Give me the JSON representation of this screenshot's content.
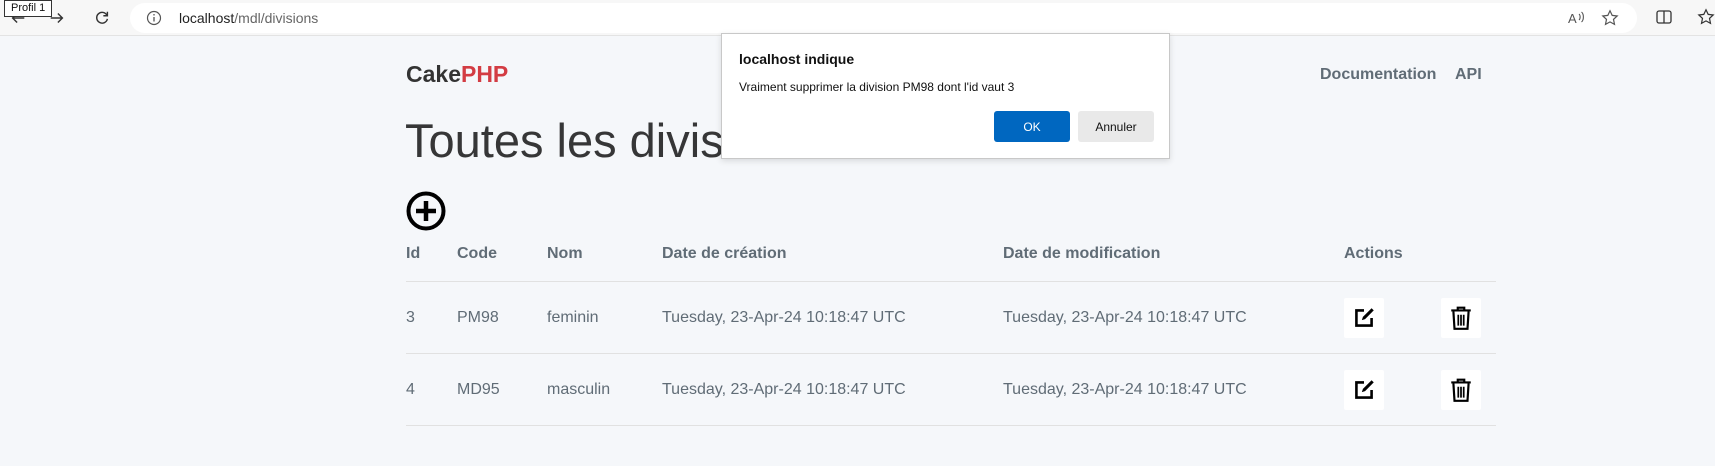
{
  "browser": {
    "profile_tooltip": "Profil 1",
    "url_host": "localhost",
    "url_path": "/mdl/divisions"
  },
  "header": {
    "logo_part1": "Cake",
    "logo_part2": "PHP",
    "logo_accent_color": "#d33c43",
    "nav": [
      "Documentation",
      "API"
    ]
  },
  "main": {
    "title": "Toutes les divisions",
    "add_icon": "plus-circle-icon",
    "columns": [
      "Id",
      "Code",
      "Nom",
      "Date de création",
      "Date de modification",
      "Actions"
    ],
    "rows": [
      {
        "id": "3",
        "code": "PM98",
        "nom": "feminin",
        "created": "Tuesday, 23-Apr-24 10:18:47 UTC",
        "modified": "Tuesday, 23-Apr-24 10:18:47 UTC"
      },
      {
        "id": "4",
        "code": "MD95",
        "nom": "masculin",
        "created": "Tuesday, 23-Apr-24 10:18:47 UTC",
        "modified": "Tuesday, 23-Apr-24 10:18:47 UTC"
      }
    ],
    "action_icons": [
      "edit-icon",
      "trash-icon"
    ]
  },
  "dialog": {
    "title": "localhost indique",
    "message": "Vraiment supprimer la division PM98 dont l'id vaut 3",
    "ok_label": "OK",
    "cancel_label": "Annuler",
    "ok_color": "#0067c0"
  }
}
